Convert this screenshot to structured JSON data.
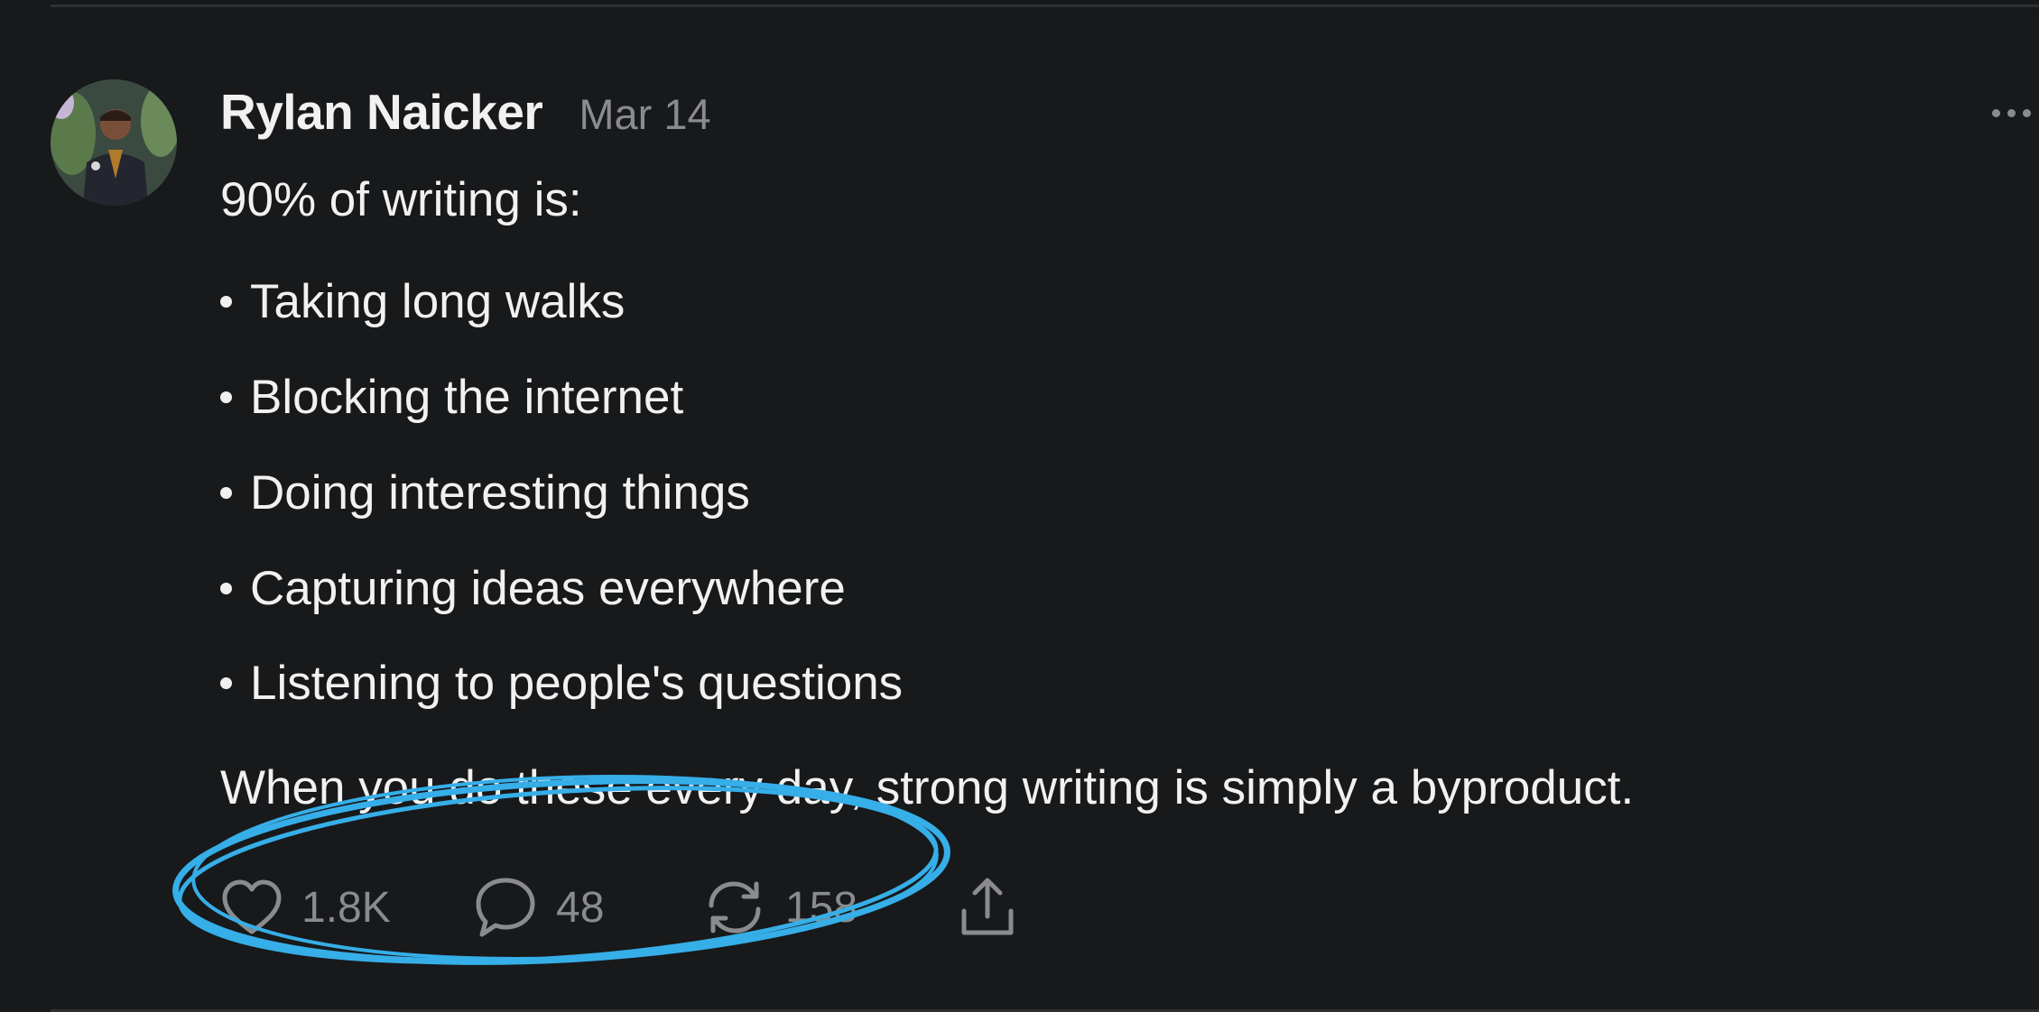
{
  "post": {
    "author": "Rylan Naicker",
    "date": "Mar 14",
    "intro": "90% of writing is:",
    "bullets": [
      "Taking long walks",
      "Blocking the internet",
      "Doing interesting things",
      "Capturing ideas everywhere",
      "Listening to people's questions"
    ],
    "closing": "When you do these every day, strong writing is simply a byproduct."
  },
  "actions": {
    "likes": "1.8K",
    "comments": "48",
    "reposts": "158"
  },
  "icons": {
    "more": "more-horizontal-icon",
    "like": "heart-icon",
    "comment": "comment-bubble-icon",
    "repost": "repost-icon",
    "share": "share-icon"
  },
  "colors": {
    "background": "#18191b",
    "text": "#f1f1f1",
    "muted": "#8a8b8f",
    "annotation": "#36aee8"
  }
}
